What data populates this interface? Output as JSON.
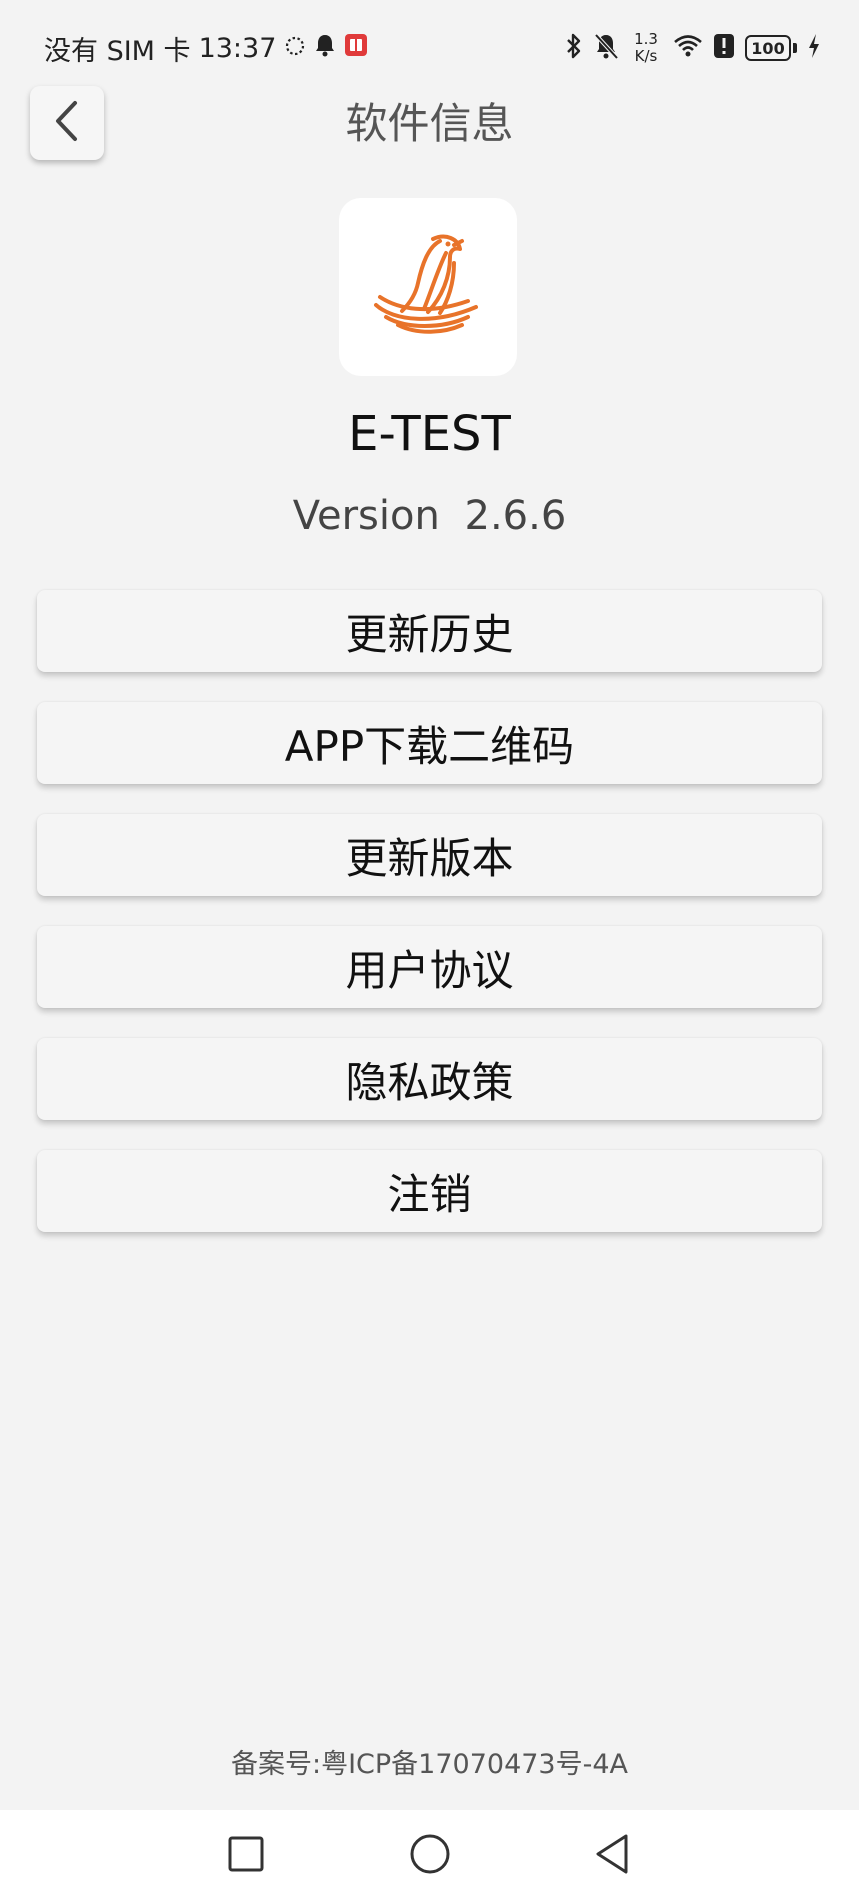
{
  "status_bar": {
    "carrier": "没有 SIM 卡",
    "time": "13:37",
    "net_speed_value": "1.3",
    "net_speed_unit": "K/s",
    "battery": "100",
    "left_icons": [
      "loading-circle-icon",
      "bell-icon",
      "app-notification-icon"
    ],
    "right_icons": [
      "bluetooth-icon",
      "bell-off-icon",
      "wifi-icon",
      "alert-icon",
      "charging-icon"
    ]
  },
  "header": {
    "title": "软件信息",
    "back_icon": "chevron-left-icon"
  },
  "app": {
    "logo_icon": "phoenix-boat-logo",
    "name": "E-TEST",
    "version_label": "Version",
    "version_number": "2.6.6",
    "accent_color": "#e8732a"
  },
  "menu": {
    "items": [
      {
        "label": "更新历史"
      },
      {
        "label": "APP下载二维码"
      },
      {
        "label": "更新版本"
      },
      {
        "label": "用户协议"
      },
      {
        "label": "隐私政策"
      },
      {
        "label": "注销"
      }
    ]
  },
  "footer": {
    "record_number": "备案号:粤ICP备17070473号-4A"
  },
  "nav_bar": {
    "icons": [
      "recent-apps-icon",
      "home-icon",
      "back-icon"
    ]
  }
}
